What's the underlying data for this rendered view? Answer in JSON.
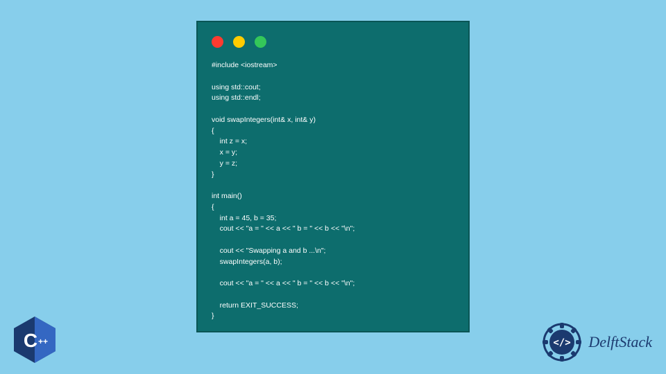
{
  "code": {
    "lines": "#include <iostream>\n\nusing std::cout;\nusing std::endl;\n\nvoid swapIntegers(int& x, int& y)\n{\n    int z = x;\n    x = y;\n    y = z;\n}\n\nint main()\n{\n    int a = 45, b = 35;\n    cout << \"a = \" << a << \" b = \" << b << \"\\n\";\n\n    cout << \"Swapping a and b ...\\n\";\n    swapIntegers(a, b);\n\n    cout << \"a = \" << a << \" b = \" << b << \"\\n\";\n\n    return EXIT_SUCCESS;\n}"
  },
  "cpp_badge": {
    "letter": "C",
    "plus": "++"
  },
  "brand": {
    "name": "DelftStack"
  },
  "colors": {
    "background": "#87ceeb",
    "window": "#0d6d6d",
    "brand": "#1b3a6f"
  }
}
